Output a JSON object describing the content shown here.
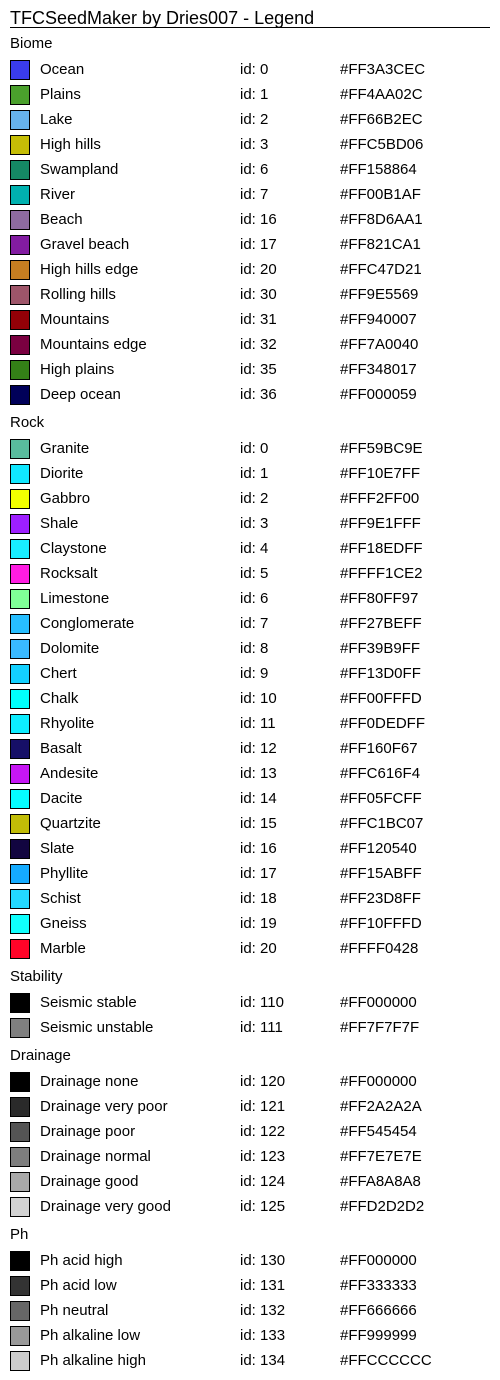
{
  "title": "TFCSeedMaker by Dries007 - Legend",
  "sections": [
    {
      "title": "Biome",
      "items": [
        {
          "name": "Ocean",
          "id": "id: 0",
          "hex": "#FF3A3CEC",
          "color": "#3A3CEC"
        },
        {
          "name": "Plains",
          "id": "id: 1",
          "hex": "#FF4AA02C",
          "color": "#4AA02C"
        },
        {
          "name": "Lake",
          "id": "id: 2",
          "hex": "#FF66B2EC",
          "color": "#66B2EC"
        },
        {
          "name": "High hills",
          "id": "id: 3",
          "hex": "#FFC5BD06",
          "color": "#C5BD06"
        },
        {
          "name": "Swampland",
          "id": "id: 6",
          "hex": "#FF158864",
          "color": "#158864"
        },
        {
          "name": "River",
          "id": "id: 7",
          "hex": "#FF00B1AF",
          "color": "#00B1AF"
        },
        {
          "name": "Beach",
          "id": "id: 16",
          "hex": "#FF8D6AA1",
          "color": "#8D6AA1"
        },
        {
          "name": "Gravel beach",
          "id": "id: 17",
          "hex": "#FF821CA1",
          "color": "#821CA1"
        },
        {
          "name": "High hills edge",
          "id": "id: 20",
          "hex": "#FFC47D21",
          "color": "#C47D21"
        },
        {
          "name": "Rolling hills",
          "id": "id: 30",
          "hex": "#FF9E5569",
          "color": "#9E5569"
        },
        {
          "name": "Mountains",
          "id": "id: 31",
          "hex": "#FF940007",
          "color": "#940007"
        },
        {
          "name": "Mountains edge",
          "id": "id: 32",
          "hex": "#FF7A0040",
          "color": "#7A0040"
        },
        {
          "name": "High plains",
          "id": "id: 35",
          "hex": "#FF348017",
          "color": "#348017"
        },
        {
          "name": "Deep ocean",
          "id": "id: 36",
          "hex": "#FF000059",
          "color": "#000059"
        }
      ]
    },
    {
      "title": "Rock",
      "items": [
        {
          "name": "Granite",
          "id": "id: 0",
          "hex": "#FF59BC9E",
          "color": "#59BC9E"
        },
        {
          "name": "Diorite",
          "id": "id: 1",
          "hex": "#FF10E7FF",
          "color": "#10E7FF"
        },
        {
          "name": "Gabbro",
          "id": "id: 2",
          "hex": "#FFF2FF00",
          "color": "#F2FF00"
        },
        {
          "name": "Shale",
          "id": "id: 3",
          "hex": "#FF9E1FFF",
          "color": "#9E1FFF"
        },
        {
          "name": "Claystone",
          "id": "id: 4",
          "hex": "#FF18EDFF",
          "color": "#18EDFF"
        },
        {
          "name": "Rocksalt",
          "id": "id: 5",
          "hex": "#FFFF1CE2",
          "color": "#FF1CE2"
        },
        {
          "name": "Limestone",
          "id": "id: 6",
          "hex": "#FF80FF97",
          "color": "#80FF97"
        },
        {
          "name": "Conglomerate",
          "id": "id: 7",
          "hex": "#FF27BEFF",
          "color": "#27BEFF"
        },
        {
          "name": "Dolomite",
          "id": "id: 8",
          "hex": "#FF39B9FF",
          "color": "#39B9FF"
        },
        {
          "name": "Chert",
          "id": "id: 9",
          "hex": "#FF13D0FF",
          "color": "#13D0FF"
        },
        {
          "name": "Chalk",
          "id": "id: 10",
          "hex": "#FF00FFFD",
          "color": "#00FFFD"
        },
        {
          "name": "Rhyolite",
          "id": "id: 11",
          "hex": "#FF0DEDFF",
          "color": "#0DEDFF"
        },
        {
          "name": "Basalt",
          "id": "id: 12",
          "hex": "#FF160F67",
          "color": "#160F67"
        },
        {
          "name": "Andesite",
          "id": "id: 13",
          "hex": "#FFC616F4",
          "color": "#C616F4"
        },
        {
          "name": "Dacite",
          "id": "id: 14",
          "hex": "#FF05FCFF",
          "color": "#05FCFF"
        },
        {
          "name": "Quartzite",
          "id": "id: 15",
          "hex": "#FFC1BC07",
          "color": "#C1BC07"
        },
        {
          "name": "Slate",
          "id": "id: 16",
          "hex": "#FF120540",
          "color": "#120540"
        },
        {
          "name": "Phyllite",
          "id": "id: 17",
          "hex": "#FF15ABFF",
          "color": "#15ABFF"
        },
        {
          "name": "Schist",
          "id": "id: 18",
          "hex": "#FF23D8FF",
          "color": "#23D8FF"
        },
        {
          "name": "Gneiss",
          "id": "id: 19",
          "hex": "#FF10FFFD",
          "color": "#10FFFD"
        },
        {
          "name": "Marble",
          "id": "id: 20",
          "hex": "#FFFF0428",
          "color": "#FF0428"
        }
      ]
    },
    {
      "title": "Stability",
      "items": [
        {
          "name": "Seismic stable",
          "id": "id: 110",
          "hex": "#FF000000",
          "color": "#000000"
        },
        {
          "name": "Seismic unstable",
          "id": "id: 111",
          "hex": "#FF7F7F7F",
          "color": "#7F7F7F"
        }
      ]
    },
    {
      "title": "Drainage",
      "items": [
        {
          "name": "Drainage none",
          "id": "id: 120",
          "hex": "#FF000000",
          "color": "#000000"
        },
        {
          "name": "Drainage very poor",
          "id": "id: 121",
          "hex": "#FF2A2A2A",
          "color": "#2A2A2A"
        },
        {
          "name": "Drainage poor",
          "id": "id: 122",
          "hex": "#FF545454",
          "color": "#545454"
        },
        {
          "name": "Drainage normal",
          "id": "id: 123",
          "hex": "#FF7E7E7E",
          "color": "#7E7E7E"
        },
        {
          "name": "Drainage good",
          "id": "id: 124",
          "hex": "#FFA8A8A8",
          "color": "#A8A8A8"
        },
        {
          "name": "Drainage very good",
          "id": "id: 125",
          "hex": "#FFD2D2D2",
          "color": "#D2D2D2"
        }
      ]
    },
    {
      "title": "Ph",
      "items": [
        {
          "name": "Ph acid high",
          "id": "id: 130",
          "hex": "#FF000000",
          "color": "#000000"
        },
        {
          "name": "Ph acid low",
          "id": "id: 131",
          "hex": "#FF333333",
          "color": "#333333"
        },
        {
          "name": "Ph neutral",
          "id": "id: 132",
          "hex": "#FF666666",
          "color": "#666666"
        },
        {
          "name": "Ph alkaline low",
          "id": "id: 133",
          "hex": "#FF999999",
          "color": "#999999"
        },
        {
          "name": "Ph alkaline high",
          "id": "id: 134",
          "hex": "#FFCCCCCC",
          "color": "#CCCCCC"
        }
      ]
    }
  ]
}
